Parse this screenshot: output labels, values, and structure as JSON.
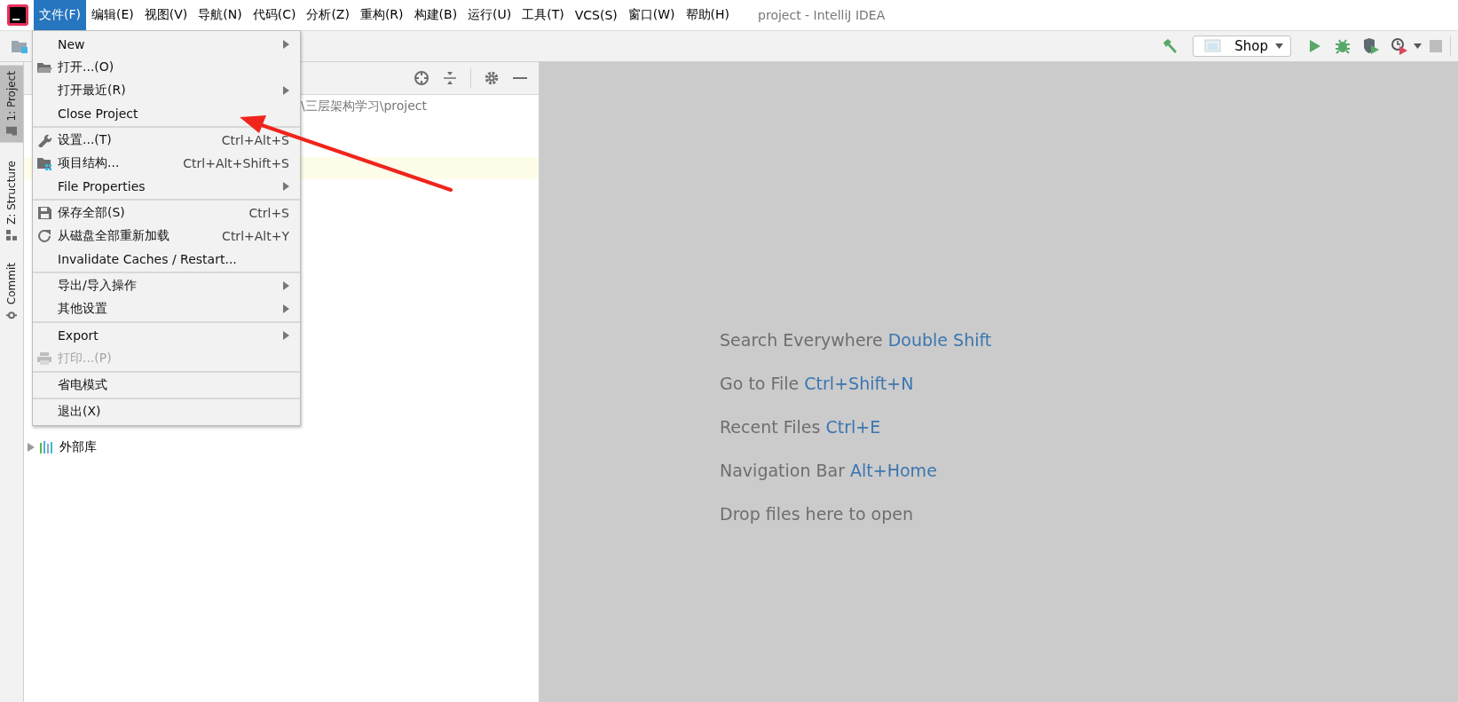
{
  "menubar": {
    "items": [
      {
        "label": "文件(F)",
        "selected": true
      },
      {
        "label": "编辑(E)",
        "selected": false
      },
      {
        "label": "视图(V)",
        "selected": false
      },
      {
        "label": "导航(N)",
        "selected": false
      },
      {
        "label": "代码(C)",
        "selected": false
      },
      {
        "label": "分析(Z)",
        "selected": false
      },
      {
        "label": "重构(R)",
        "selected": false
      },
      {
        "label": "构建(B)",
        "selected": false
      },
      {
        "label": "运行(U)",
        "selected": false
      },
      {
        "label": "工具(T)",
        "selected": false
      },
      {
        "label": "VCS(S)",
        "selected": false
      },
      {
        "label": "窗口(W)",
        "selected": false
      },
      {
        "label": "帮助(H)",
        "selected": false
      }
    ],
    "title": "project - IntelliJ IDEA"
  },
  "toolbar": {
    "run_configuration": "Shop"
  },
  "tool_window_tabs": [
    {
      "label": "1: Project",
      "selected": true
    },
    {
      "label": "Z: Structure",
      "selected": false
    },
    {
      "label": "Commit",
      "selected": false
    }
  ],
  "project_panel": {
    "path": "\\三层架构学习\\project",
    "tree": [
      {
        "label": "外部库",
        "expanded": false
      }
    ]
  },
  "file_menu": {
    "groups": [
      [
        {
          "label": "New",
          "submenu": true,
          "disabled": false
        },
        {
          "label": "打开...(O)",
          "submenu": false,
          "disabled": false
        },
        {
          "label": "打开最近(R)",
          "submenu": true,
          "disabled": false
        },
        {
          "label": "Close Project",
          "submenu": false,
          "disabled": false
        }
      ],
      [
        {
          "label": "设置...(T)",
          "shortcut": "Ctrl+Alt+S",
          "submenu": false,
          "disabled": false
        },
        {
          "label": "项目结构...",
          "shortcut": "Ctrl+Alt+Shift+S",
          "submenu": false,
          "disabled": false
        },
        {
          "label": "File Properties",
          "submenu": true,
          "disabled": false
        }
      ],
      [
        {
          "label": "保存全部(S)",
          "shortcut": "Ctrl+S",
          "submenu": false,
          "disabled": false
        },
        {
          "label": "从磁盘全部重新加载",
          "shortcut": "Ctrl+Alt+Y",
          "submenu": false,
          "disabled": false
        },
        {
          "label": "Invalidate Caches / Restart...",
          "submenu": false,
          "disabled": false
        }
      ],
      [
        {
          "label": "导出/导入操作",
          "submenu": true,
          "disabled": false
        },
        {
          "label": "其他设置",
          "submenu": true,
          "disabled": false
        }
      ],
      [
        {
          "label": "Export",
          "submenu": true,
          "disabled": false
        },
        {
          "label": "打印...(P)",
          "submenu": false,
          "disabled": true
        }
      ],
      [
        {
          "label": "省电模式",
          "submenu": false,
          "disabled": false
        }
      ],
      [
        {
          "label": "退出(X)",
          "submenu": false,
          "disabled": false
        }
      ]
    ]
  },
  "editor_hints": [
    {
      "text": "Search Everywhere",
      "shortcut": "Double Shift"
    },
    {
      "text": "Go to File",
      "shortcut": "Ctrl+Shift+N"
    },
    {
      "text": "Recent Files",
      "shortcut": "Ctrl+E"
    },
    {
      "text": "Navigation Bar",
      "shortcut": "Alt+Home"
    },
    {
      "text": "Drop files here to open"
    }
  ]
}
